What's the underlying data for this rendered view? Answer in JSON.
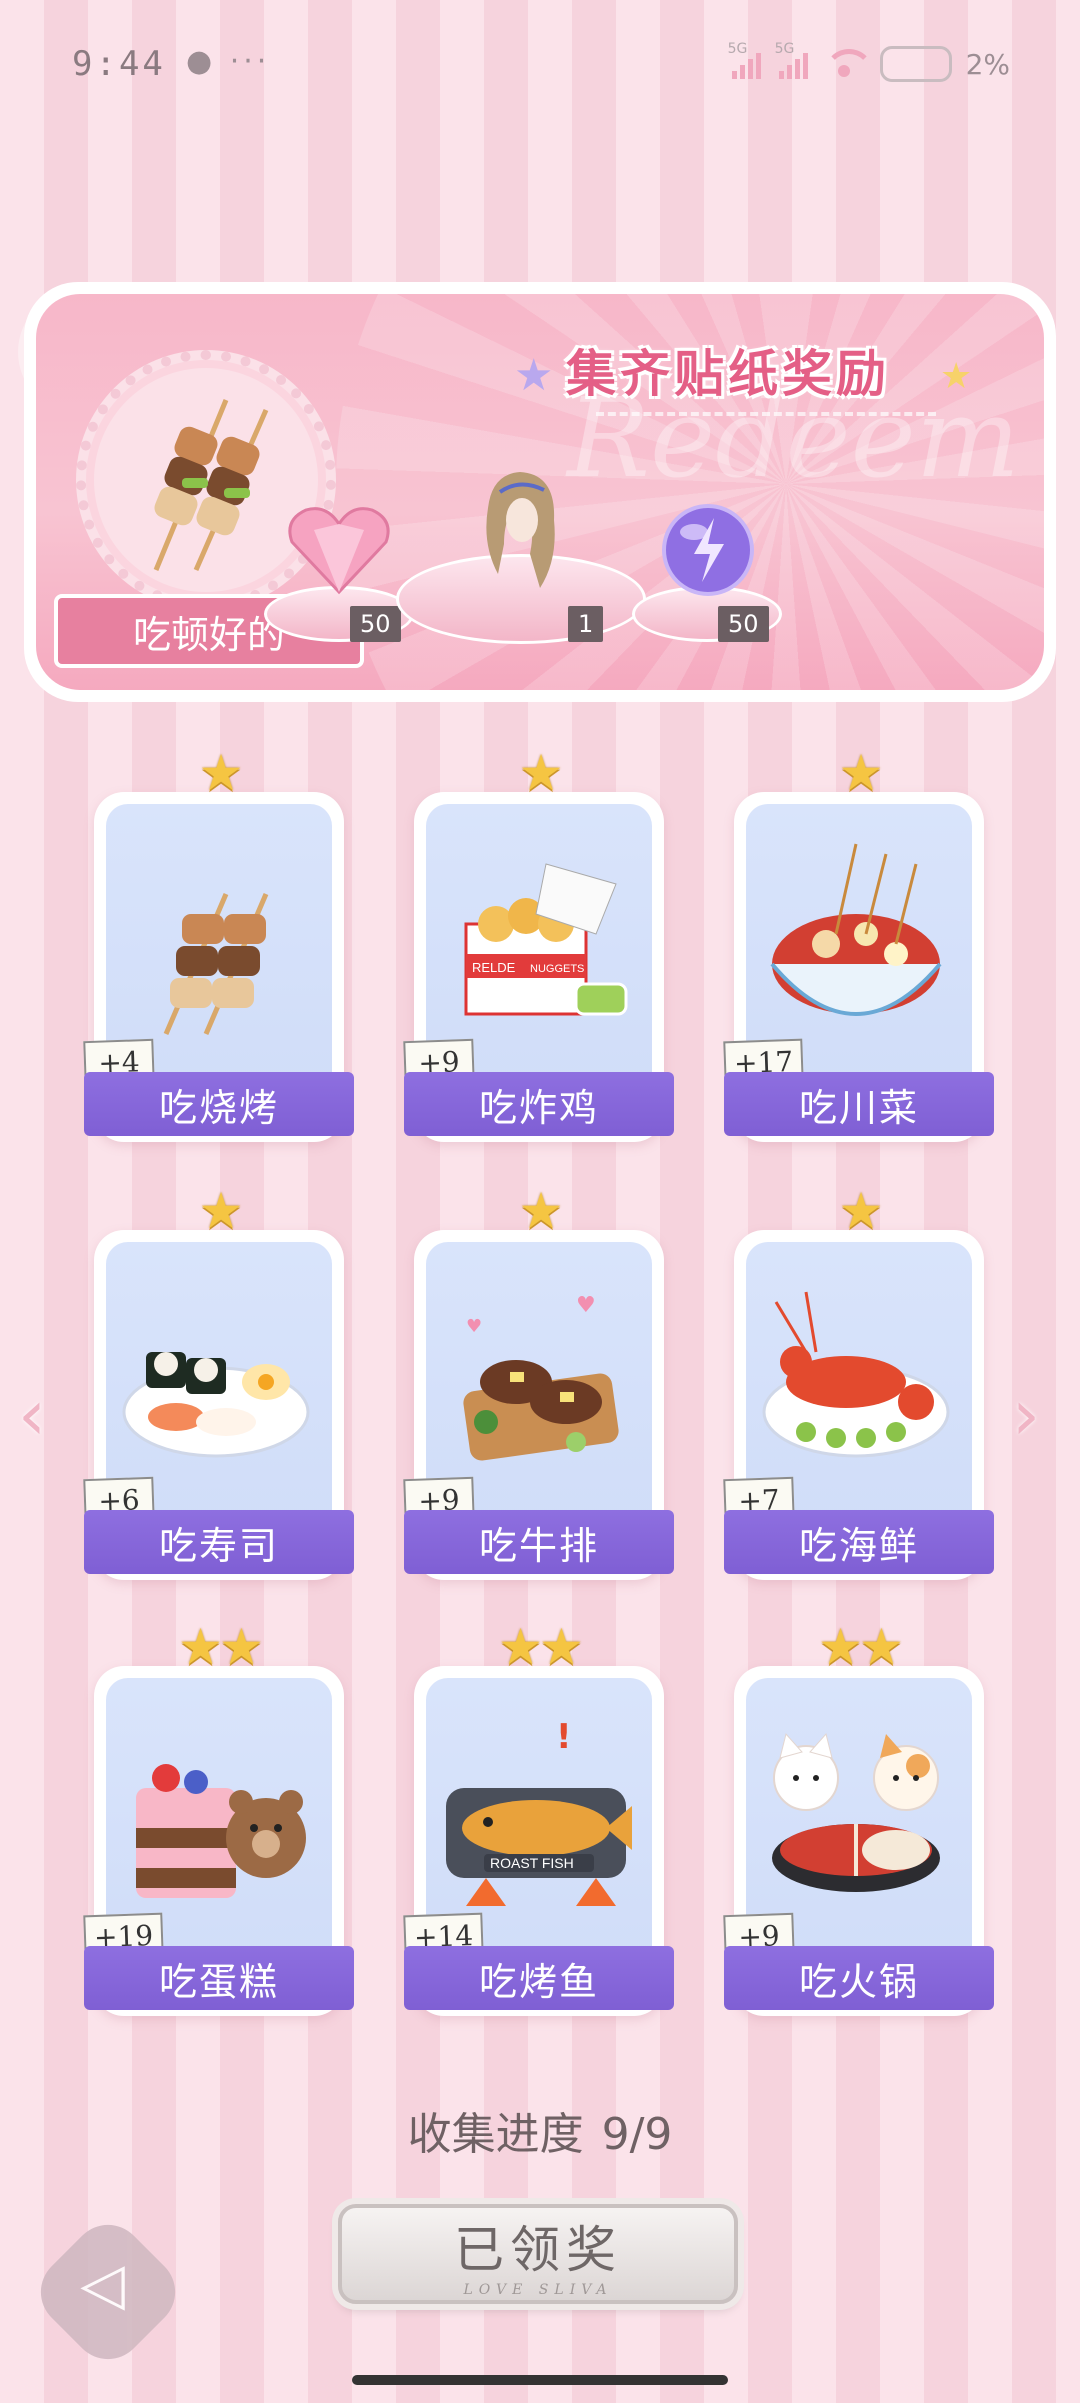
{
  "status_bar": {
    "time": "9:44",
    "dots": "● ···",
    "signal_label_1": "5G",
    "signal_label_2": "5G",
    "battery": "2%"
  },
  "banner": {
    "title": "集齐贴纸奖励",
    "watermark": "Redeem",
    "theme_label": "吃顿好的",
    "rewards": [
      {
        "name": "pink-heart-gem",
        "count": "50"
      },
      {
        "name": "hairstyle-item",
        "count": "1"
      },
      {
        "name": "purple-energy-orb",
        "count": "50"
      }
    ]
  },
  "stickers": [
    {
      "label": "吃烧烤",
      "bonus": "+4",
      "stars": "★"
    },
    {
      "label": "吃炸鸡",
      "bonus": "+9",
      "stars": "★"
    },
    {
      "label": "吃川菜",
      "bonus": "+17",
      "stars": "★"
    },
    {
      "label": "吃寿司",
      "bonus": "+6",
      "stars": "★"
    },
    {
      "label": "吃牛排",
      "bonus": "+9",
      "stars": "★"
    },
    {
      "label": "吃海鲜",
      "bonus": "+7",
      "stars": "★"
    },
    {
      "label": "吃蛋糕",
      "bonus": "+19",
      "stars": "★★"
    },
    {
      "label": "吃烤鱼",
      "bonus": "+14",
      "stars": "★★"
    },
    {
      "label": "吃火锅",
      "bonus": "+9",
      "stars": "★★"
    }
  ],
  "sticker_art_text": {
    "chicken_box_left": "RELDE",
    "chicken_box_right": "NUGGETS",
    "roast_fish_tray": "ROAST FISH"
  },
  "progress": {
    "label": "收集进度",
    "value": "9/9"
  },
  "claim_button": {
    "label": "已领奖",
    "sub": "LOVE SLIVA"
  },
  "nav": {
    "prev": "‹",
    "next": "›",
    "back": "◁"
  },
  "colors": {
    "accent_pink": "#e45f86",
    "label_purple": "#8e6fe0",
    "star_gold": "#f5c542"
  }
}
